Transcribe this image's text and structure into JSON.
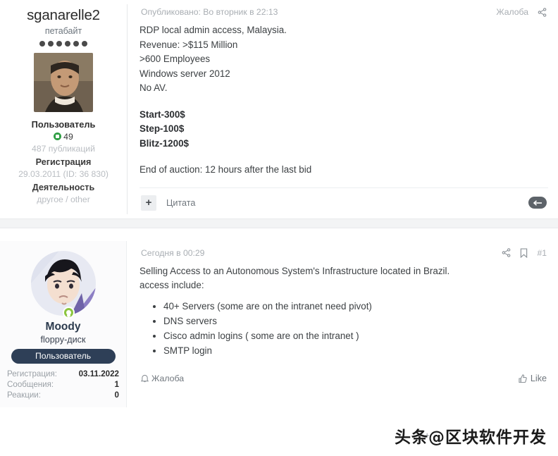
{
  "posts": [
    {
      "user": {
        "name": "sganarelle2",
        "title": "петабайт",
        "rank_dots": 6,
        "role": "Пользователь",
        "reputation": "49",
        "publications": "487 публикаций",
        "registration_label": "Регистрация",
        "registration_value": "29.03.2011 (ID: 36 830)",
        "activity_label": "Деятельность",
        "activity_value": "другое / other"
      },
      "header": {
        "posted": "Опубликовано: Во вторник в 22:13",
        "report": "Жалоба",
        "share_icon": "share-icon"
      },
      "body": {
        "lines": [
          "RDP local admin access, Malaysia.",
          "Revenue: >$115 Million",
          ">600 Employees",
          "Windows server 2012",
          "No AV."
        ],
        "price_lines": [
          "Start-300$",
          "Step-100$",
          "Blitz-1200$"
        ],
        "end_line": "End of auction: 12 hours after the last bid"
      },
      "footer": {
        "plus": "+",
        "quote": "Цитата",
        "reply_icon": "reply-icon"
      }
    },
    {
      "user": {
        "name": "Moody",
        "title": "floppy-диск",
        "role_badge": "Пользователь",
        "online": true,
        "stats": [
          {
            "label": "Регистрация:",
            "value": "03.11.2022"
          },
          {
            "label": "Сообщения:",
            "value": "1"
          },
          {
            "label": "Реакции:",
            "value": "0"
          }
        ]
      },
      "header": {
        "posted": "Сегодня в 00:29",
        "share_icon": "share-icon",
        "bookmark_icon": "bookmark-icon",
        "post_number": "#1"
      },
      "body": {
        "lines": [
          "Selling Access to an Autonomous System's Infrastructure located in Brazil.",
          "access include:"
        ],
        "bullets": [
          "40+ Servers (some are on the intranet need pivot)",
          "DNS servers",
          "Cisco admin logins ( some are on the intranet )",
          "SMTP login"
        ]
      },
      "footer": {
        "report": "Жалоба",
        "report_icon": "report-bell-icon",
        "like": "Like",
        "like_icon": "thumbs-up-icon",
        "quote_plus": "+"
      }
    }
  ],
  "watermark": {
    "text": "头条@区块软件开发"
  },
  "colors": {
    "text": "#3c4043",
    "muted": "#a9aeb3",
    "badge_navy": "#2e3f57",
    "online_green": "#8bc53f",
    "rep_green": "#2f9e44"
  }
}
